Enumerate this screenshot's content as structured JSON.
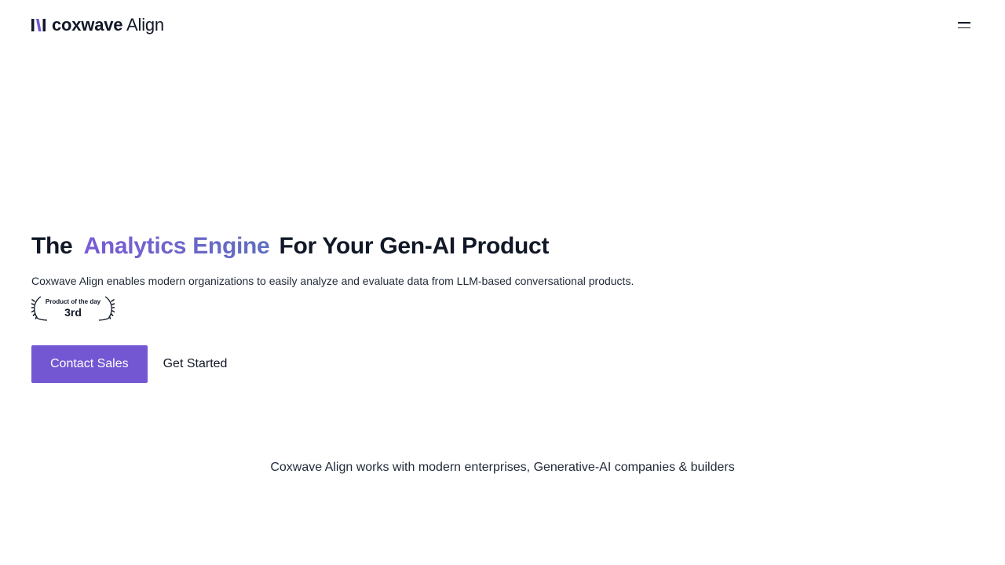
{
  "header": {
    "logo_brand": "coxwave",
    "logo_product": "Align",
    "logo_colors": {
      "bar1": "#111827",
      "bar2": "#7357d2",
      "bar3": "#111827"
    },
    "menu_icon": "hamburger-icon"
  },
  "hero": {
    "headline_pre": "The",
    "headline_accent": "Analytics Engine",
    "headline_post": "For Your Gen-AI Product",
    "subtitle": "Coxwave Align enables modern organizations to easily analyze and evaluate data from LLM-based conversational products.",
    "award": {
      "title": "Product of the day",
      "rank": "3rd",
      "icon": "laurel-icon"
    },
    "primary_button": "Contact Sales",
    "secondary_button": "Get Started"
  },
  "trust": {
    "text": "Coxwave Align works with modern enterprises, Generative-AI companies & builders"
  },
  "colors": {
    "accent": "#7357d2",
    "accent_gradient_end": "#5f6fbf",
    "text": "#111827"
  }
}
